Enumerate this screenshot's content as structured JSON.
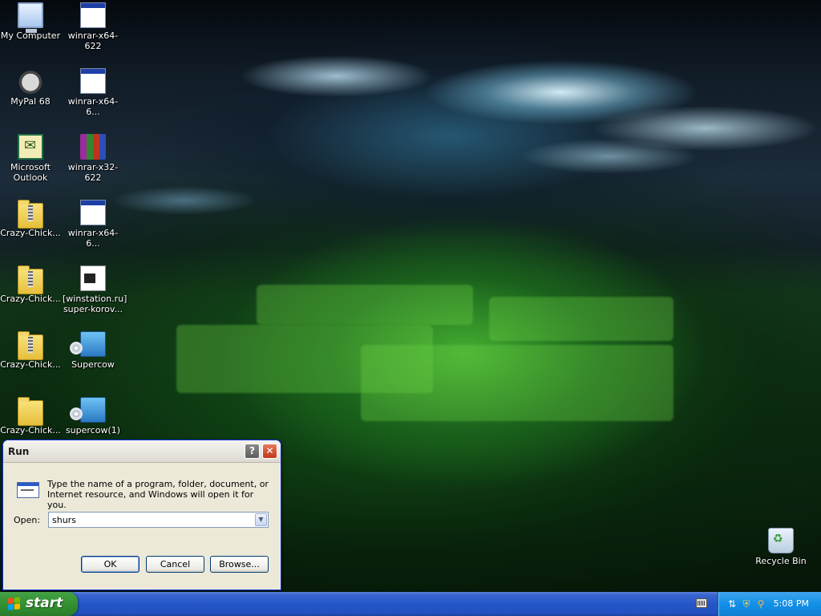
{
  "desktop": {
    "icons": [
      {
        "label": "My Computer",
        "icon": "my-computer-icon"
      },
      {
        "label": "winrar-x64-622",
        "icon": "application-window-icon"
      },
      {
        "label": "MyPal 68",
        "icon": "mypal-browser-icon"
      },
      {
        "label": "winrar-x64-6...",
        "icon": "application-window-icon"
      },
      {
        "label": "Microsoft\nOutlook",
        "icon": "outlook-icon"
      },
      {
        "label": "winrar-x32-622",
        "icon": "winrar-archive-icon"
      },
      {
        "label": "Crazy-Chick...",
        "icon": "zip-folder-icon"
      },
      {
        "label": "winrar-x64-6...",
        "icon": "application-window-icon"
      },
      {
        "label": "Crazy-Chick...",
        "icon": "zip-folder-icon"
      },
      {
        "label": "[winstation.ru]\nsuper-korov...",
        "icon": "document-icon"
      },
      {
        "label": "Crazy-Chick...",
        "icon": "zip-folder-icon"
      },
      {
        "label": "Supercow",
        "icon": "setup-installer-icon"
      },
      {
        "label": "Crazy-Chick...",
        "icon": "folder-icon"
      },
      {
        "label": "supercow(1)",
        "icon": "setup-installer-icon"
      },
      {
        "label": "Recycle Bin",
        "icon": "recycle-bin-icon"
      }
    ]
  },
  "run_dialog": {
    "title": "Run",
    "help_glyph": "?",
    "close_glyph": "✕",
    "description": "Type the name of a program, folder, document, or Internet resource, and Windows will open it for you.",
    "open_label": "Open:",
    "open_value": "shurs",
    "buttons": {
      "ok": "OK",
      "cancel": "Cancel",
      "browse": "Browse..."
    }
  },
  "taskbar": {
    "start_label": "start",
    "clock": "5:08 PM",
    "tray_icons": [
      "network-icon",
      "security-shield-icon",
      "search-icon"
    ]
  },
  "colors": {
    "taskbar_blue": "#2456c8",
    "start_green": "#3c9a3c",
    "tray_blue": "#1290e8",
    "dialog_face": "#ece9d8"
  }
}
